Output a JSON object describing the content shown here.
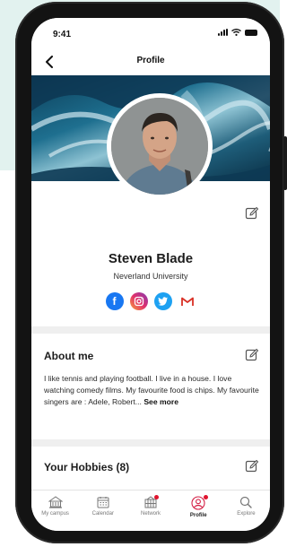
{
  "status_bar": {
    "time": "9:41"
  },
  "header": {
    "title": "Profile"
  },
  "profile": {
    "name": "Steven Blade",
    "university": "Neverland University"
  },
  "socials": [
    {
      "icon": "facebook-icon",
      "color": "#1877f2"
    },
    {
      "icon": "instagram-icon",
      "color": "#e1306c"
    },
    {
      "icon": "twitter-icon",
      "color": "#1da1f2"
    },
    {
      "icon": "gmail-icon",
      "color": "#d93025"
    }
  ],
  "about": {
    "title": "About me",
    "text": "I like tennis and playing football. I live in a house. I love watching comedy films. My favourite food is chips. My favourite singers are : Adele, Robert...",
    "see_more": "See more"
  },
  "hobbies": {
    "title": "Your Hobbies (8)"
  },
  "tabs": [
    {
      "label": "My campus",
      "icon": "campus-icon"
    },
    {
      "label": "Calendar",
      "icon": "calendar-icon"
    },
    {
      "label": "Network",
      "icon": "network-icon",
      "badge": true
    },
    {
      "label": "Profile",
      "icon": "profile-icon",
      "badge": true,
      "active": true
    },
    {
      "label": "Explore",
      "icon": "search-icon"
    }
  ],
  "colors": {
    "accent": "#d42046",
    "background_mint": "#e2f2ef",
    "text_dark": "#1d1d1d"
  }
}
